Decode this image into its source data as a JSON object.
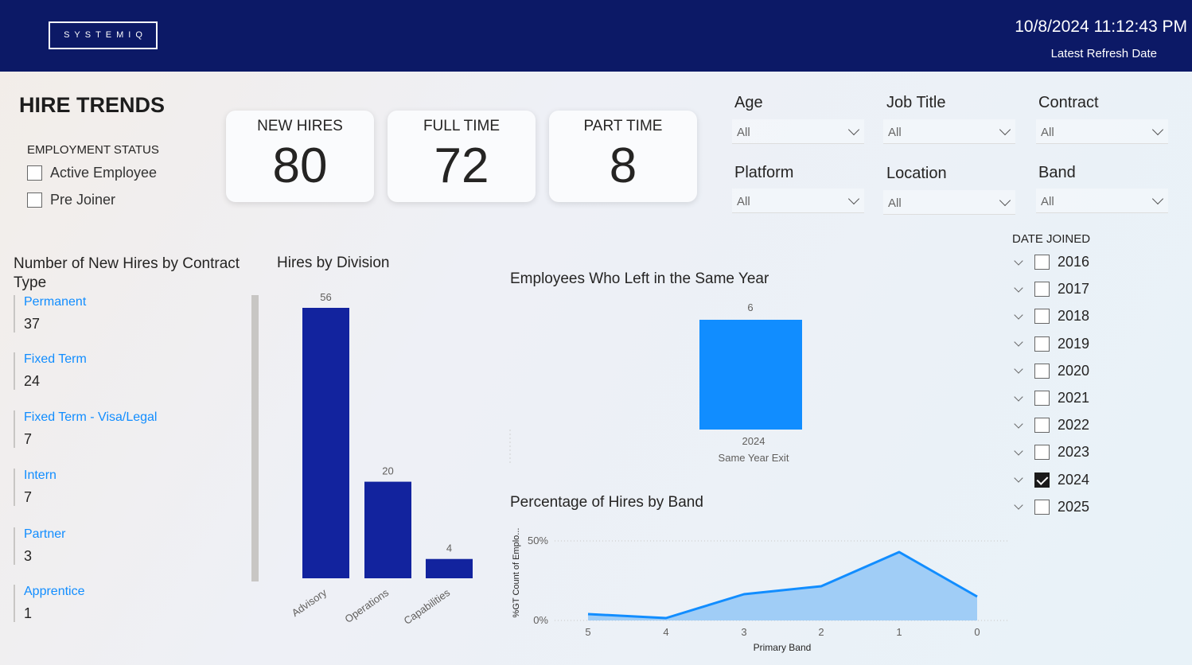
{
  "header": {
    "logo": "SYSTEMIQ",
    "refresh_date": "10/8/2024 11:12:43 PM",
    "refresh_label": "Latest Refresh Date"
  },
  "page_title": "HIRE TRENDS",
  "employment_status": {
    "title": "EMPLOYMENT STATUS",
    "options": [
      {
        "label": "Active Employee",
        "checked": false
      },
      {
        "label": "Pre Joiner",
        "checked": false
      }
    ]
  },
  "cards": [
    {
      "label": "NEW HIRES",
      "value": "80"
    },
    {
      "label": "FULL TIME",
      "value": "72"
    },
    {
      "label": "PART TIME",
      "value": "8"
    }
  ],
  "filters": [
    {
      "title": "Age",
      "value": "All"
    },
    {
      "title": "Job Title",
      "value": "All"
    },
    {
      "title": "Contract",
      "value": "All"
    },
    {
      "title": "Platform",
      "value": "All"
    },
    {
      "title": "Location",
      "value": "All"
    },
    {
      "title": "Band",
      "value": "All"
    }
  ],
  "contract_list": {
    "title": "Number of New Hires by Contract Type",
    "items": [
      {
        "name": "Permanent",
        "value": "37"
      },
      {
        "name": "Fixed Term",
        "value": "24"
      },
      {
        "name": "Fixed Term - Visa/Legal",
        "value": "7"
      },
      {
        "name": "Intern",
        "value": "7"
      },
      {
        "name": "Partner",
        "value": "3"
      },
      {
        "name": "Apprentice",
        "value": "1"
      }
    ]
  },
  "date_joined": {
    "title": "DATE JOINED",
    "years": [
      {
        "label": "2016",
        "checked": false
      },
      {
        "label": "2017",
        "checked": false
      },
      {
        "label": "2018",
        "checked": false
      },
      {
        "label": "2019",
        "checked": false
      },
      {
        "label": "2020",
        "checked": false
      },
      {
        "label": "2021",
        "checked": false
      },
      {
        "label": "2022",
        "checked": false
      },
      {
        "label": "2023",
        "checked": false
      },
      {
        "label": "2024",
        "checked": true
      },
      {
        "label": "2025",
        "checked": false
      }
    ]
  },
  "colors": {
    "header_bg": "#0c1966",
    "division_bar": "#12239e",
    "same_year_bar": "#118dff",
    "band_line": "#118dff",
    "band_area": "#9ccaf6",
    "link_blue": "#118dff"
  },
  "chart_data": [
    {
      "type": "bar",
      "title": "Hires by Division",
      "categories": [
        "Advisory",
        "Operations",
        "Capabilities"
      ],
      "values": [
        56,
        20,
        4
      ],
      "ylim": [
        0,
        56
      ]
    },
    {
      "type": "bar",
      "title": "Employees Who Left in the Same Year",
      "categories": [
        "2024"
      ],
      "xlabel": "Same Year Exit",
      "values": [
        6
      ],
      "ylim": [
        0,
        6
      ]
    },
    {
      "type": "area",
      "title": "Percentage of Hires by Band",
      "xlabel": "Primary Band",
      "ylabel": "%GT Count of Emplo...",
      "x": [
        "5",
        "4",
        "3",
        "2",
        "1",
        "0"
      ],
      "values": [
        4,
        1.5,
        16.5,
        21.5,
        43,
        15
      ],
      "yticks": [
        "0%",
        "50%"
      ],
      "ylim": [
        0,
        50
      ],
      "grid": true
    }
  ]
}
